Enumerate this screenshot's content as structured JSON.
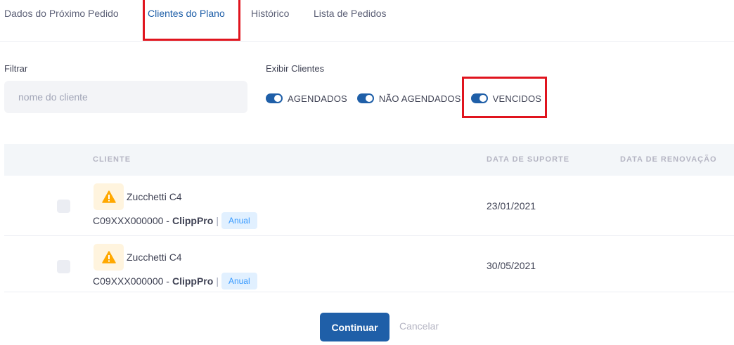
{
  "tabs": [
    {
      "label": "Dados do Próximo Pedido",
      "active": false
    },
    {
      "label": "Clientes do Plano",
      "active": true
    },
    {
      "label": "Histórico",
      "active": false
    },
    {
      "label": "Lista de Pedidos",
      "active": false
    }
  ],
  "filter": {
    "label": "Filtrar",
    "placeholder": "nome do cliente",
    "value": ""
  },
  "show_clients": {
    "label": "Exibir Clientes",
    "toggles": [
      {
        "label": "AGENDADOS",
        "on": true
      },
      {
        "label": "NÃO AGENDADOS",
        "on": true
      },
      {
        "label": "VENCIDOS",
        "on": true
      }
    ]
  },
  "table": {
    "columns": [
      "CLIENTE",
      "DATA DE SUPORTE",
      "DATA DE RENOVAÇÃO"
    ],
    "rows": [
      {
        "name": "Zucchetti C4",
        "code": "C09XXX000000 -",
        "product": "ClippPro",
        "separator": "|",
        "plan": "Anual",
        "support_date": "23/01/2021",
        "renewal_date": "",
        "icon": "warning-icon"
      },
      {
        "name": "Zucchetti C4",
        "code": "C09XXX000000 -",
        "product": "ClippPro",
        "separator": "|",
        "plan": "Anual",
        "support_date": "30/05/2021",
        "renewal_date": "",
        "icon": "warning-icon"
      }
    ]
  },
  "actions": {
    "continue_label": "Continuar",
    "cancel_label": "Cancelar"
  },
  "colors": {
    "primary": "#1f5fa8",
    "highlight": "#e0141e",
    "warning": "#ffa800",
    "badge_bg": "#e1f0ff",
    "badge_text": "#3699ff"
  }
}
